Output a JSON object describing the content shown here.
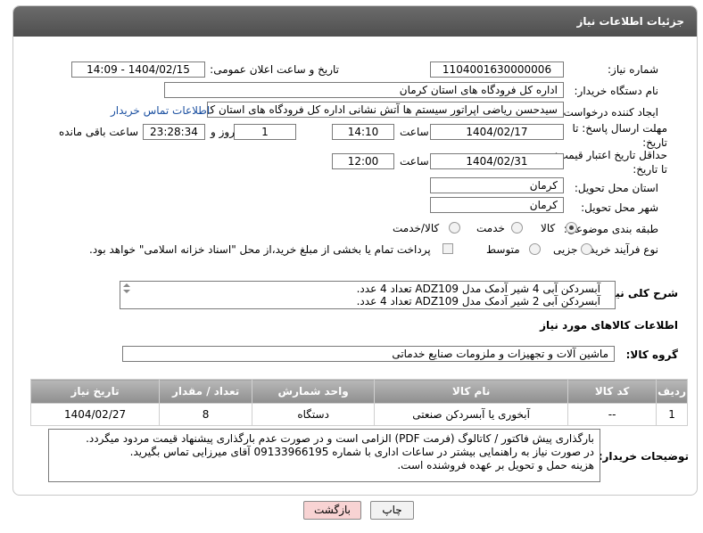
{
  "header": {
    "title": "جزئیات اطلاعات نیاز"
  },
  "form": {
    "need_number": {
      "label": "شماره نیاز:",
      "value": "1104001630000006"
    },
    "announce_datetime": {
      "label": "تاریخ و ساعت اعلان عمومی:",
      "value": "1404/02/15 - 14:09"
    },
    "buyer_org": {
      "label": "نام دستگاه خریدار:",
      "value": "اداره کل فرودگاه های استان کرمان"
    },
    "requester": {
      "label": "ایجاد کننده درخواست:",
      "value": "سیدحسن ریاضی اپراتور سیستم ها آتش نشانی اداره کل فرودگاه های استان ک",
      "contact_link": "اطلاعات تماس خریدار"
    },
    "reply_deadline": {
      "label": "مهلت ارسال پاسخ: تا تاریخ:",
      "date": "1404/02/17",
      "time_label": "ساعت",
      "time": "14:10",
      "days": "1",
      "days_label": "روز و",
      "remaining": "23:28:34",
      "remaining_label": "ساعت باقی مانده"
    },
    "price_validity": {
      "label": "حداقل تاریخ اعتبار قیمت: تا تاریخ:",
      "date": "1404/02/31",
      "time_label": "ساعت",
      "time": "12:00"
    },
    "delivery_province": {
      "label": "استان محل تحویل:",
      "value": "کرمان"
    },
    "delivery_city": {
      "label": "شهر محل تحویل:",
      "value": "کرمان"
    },
    "category": {
      "label": "طبقه بندی موضوعی:",
      "options": [
        "کالا",
        "خدمت",
        "کالا/خدمت"
      ],
      "selected": "کالا"
    },
    "purchase_type": {
      "label": "نوع فرآیند خرید :",
      "options": [
        "جزیی",
        "متوسط"
      ],
      "selected": "",
      "checkbox_label": "پرداخت تمام یا بخشی از مبلغ خرید،از محل \"اسناد خزانه اسلامی\" خواهد بود."
    }
  },
  "description": {
    "label": "شرح کلی نیاز:",
    "lines": [
      "آبسردکن آبی 4 شیر آدمک مدل ADZ109 تعداد 4 عدد.",
      "آبسردکن آبی 2 شیر آدمک مدل ADZ109 تعداد 4 عدد."
    ]
  },
  "goods_section": {
    "title": "اطلاعات کالاهای مورد نیاز"
  },
  "goods_group": {
    "label": "گروه کالا:",
    "value": "ماشین آلات و تجهیزات و ملزومات صنایع خدماتی"
  },
  "table": {
    "headers": [
      "ردیف",
      "کد کالا",
      "نام کالا",
      "واحد شمارش",
      "تعداد / مقدار",
      "تاریخ نیاز"
    ],
    "rows": [
      [
        "1",
        "--",
        "آبخوری یا آبسردکن صنعتی",
        "دستگاه",
        "8",
        "1404/02/27"
      ]
    ]
  },
  "buyer_notes": {
    "label": "توضیحات خریدار:",
    "lines": [
      "بارگذاری پیش فاکتور / کاتالوگ (فرمت PDF) الزامی است و در صورت عدم بارگذاری پیشنهاد قیمت مردود میگردد.",
      "در صورت نیاز به راهنمایی بیشتر در ساعات اداری با شماره 09133966195 آقای میرزایی  تماس بگیرید.",
      "هزینه حمل و تحویل  بر عهده فروشنده است."
    ]
  },
  "buttons": {
    "print": "چاپ",
    "back": "بازگشت"
  },
  "colors": {
    "title_bar": "#5a5a5a",
    "link": "#1a4fa0",
    "back_button": "#f8d3d3"
  }
}
